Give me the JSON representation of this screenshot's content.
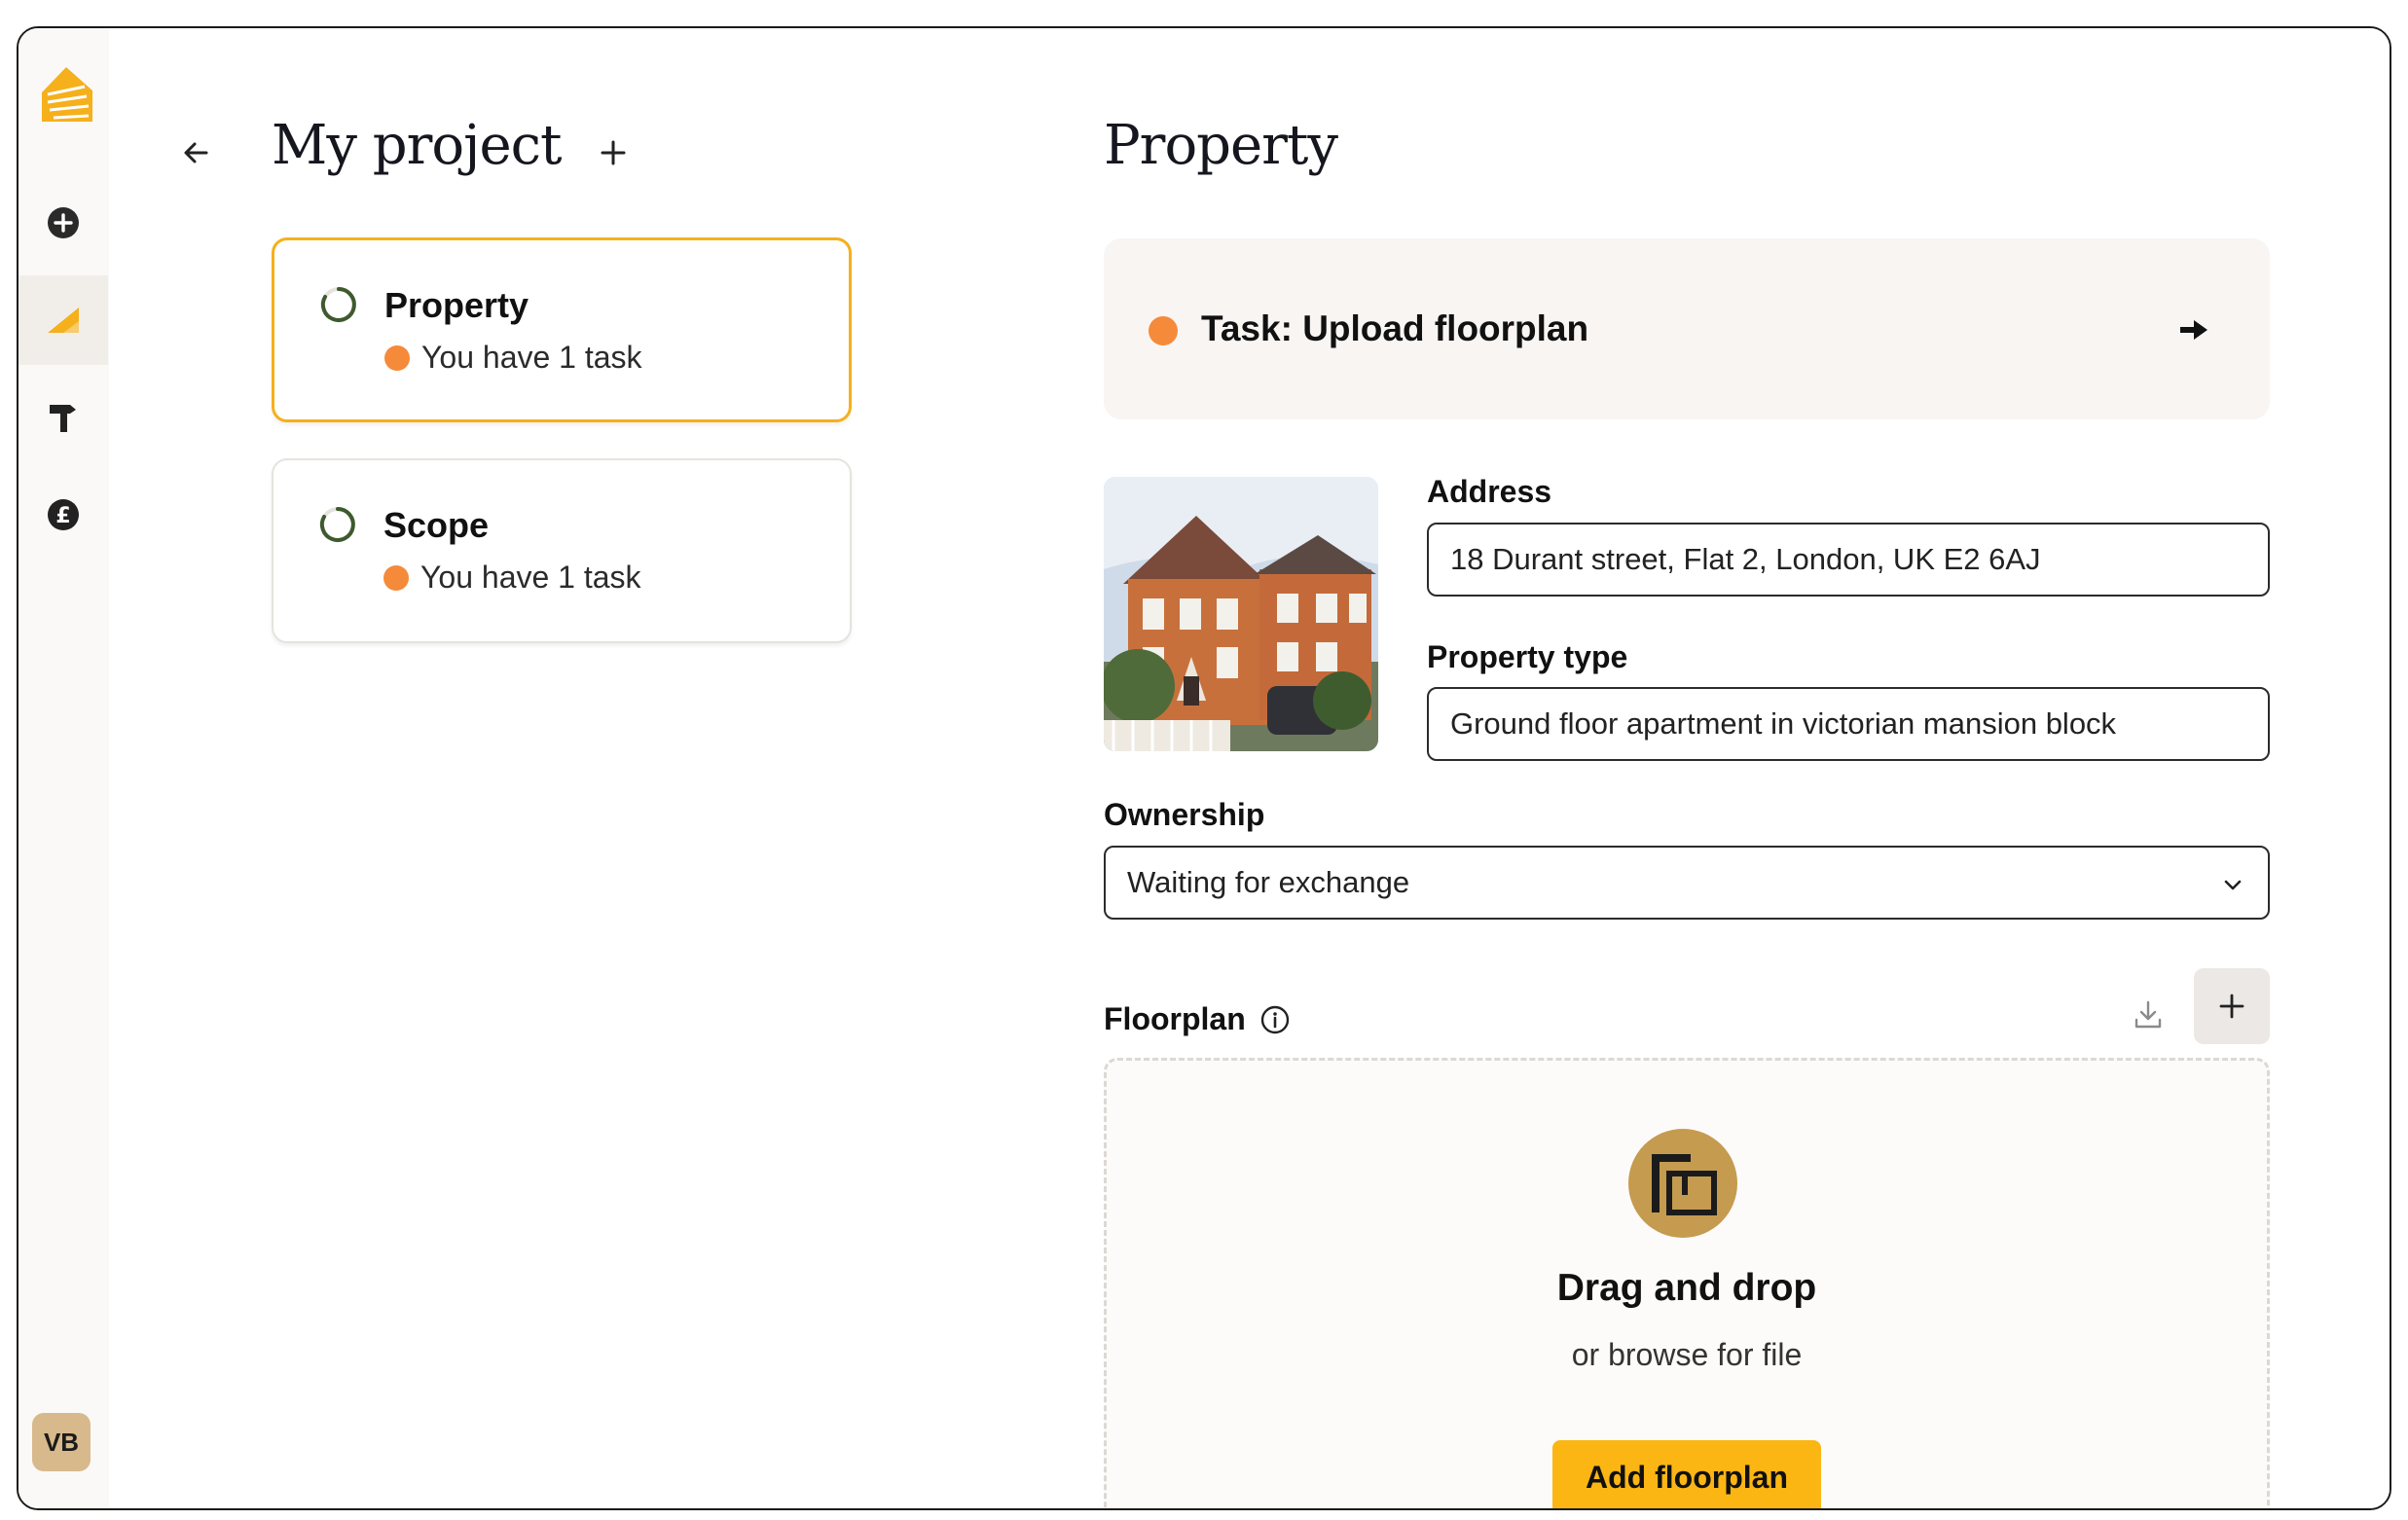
{
  "rail": {
    "avatar_initials": "VB",
    "icons": [
      "logo-icon",
      "add-circle-icon",
      "ruler-icon",
      "hammer-icon",
      "pound-icon"
    ],
    "accent": "#f5b01c"
  },
  "project": {
    "title": "My project",
    "cards": [
      {
        "title": "Property",
        "subtitle": "You have 1 task",
        "selected": true
      },
      {
        "title": "Scope",
        "subtitle": "You have 1 task",
        "selected": false
      }
    ]
  },
  "main": {
    "title": "Property",
    "task_label": "Task: Upload floorplan",
    "address_label": "Address",
    "address_value": "18 Durant street, Flat 2, London, UK E2 6AJ",
    "type_label": "Property type",
    "type_value": "Ground floor apartment in victorian mansion block",
    "ownership_label": "Ownership",
    "ownership_value": "Waiting for exchange",
    "floorplan_label": "Floorplan",
    "drop_title": "Drag and drop",
    "drop_sub": "or browse for file",
    "drop_button": "Add floorplan"
  },
  "colors": {
    "accent": "#fbb613",
    "task_dot": "#f58a3a",
    "floorplan_icon_bg": "#c59b4f"
  }
}
